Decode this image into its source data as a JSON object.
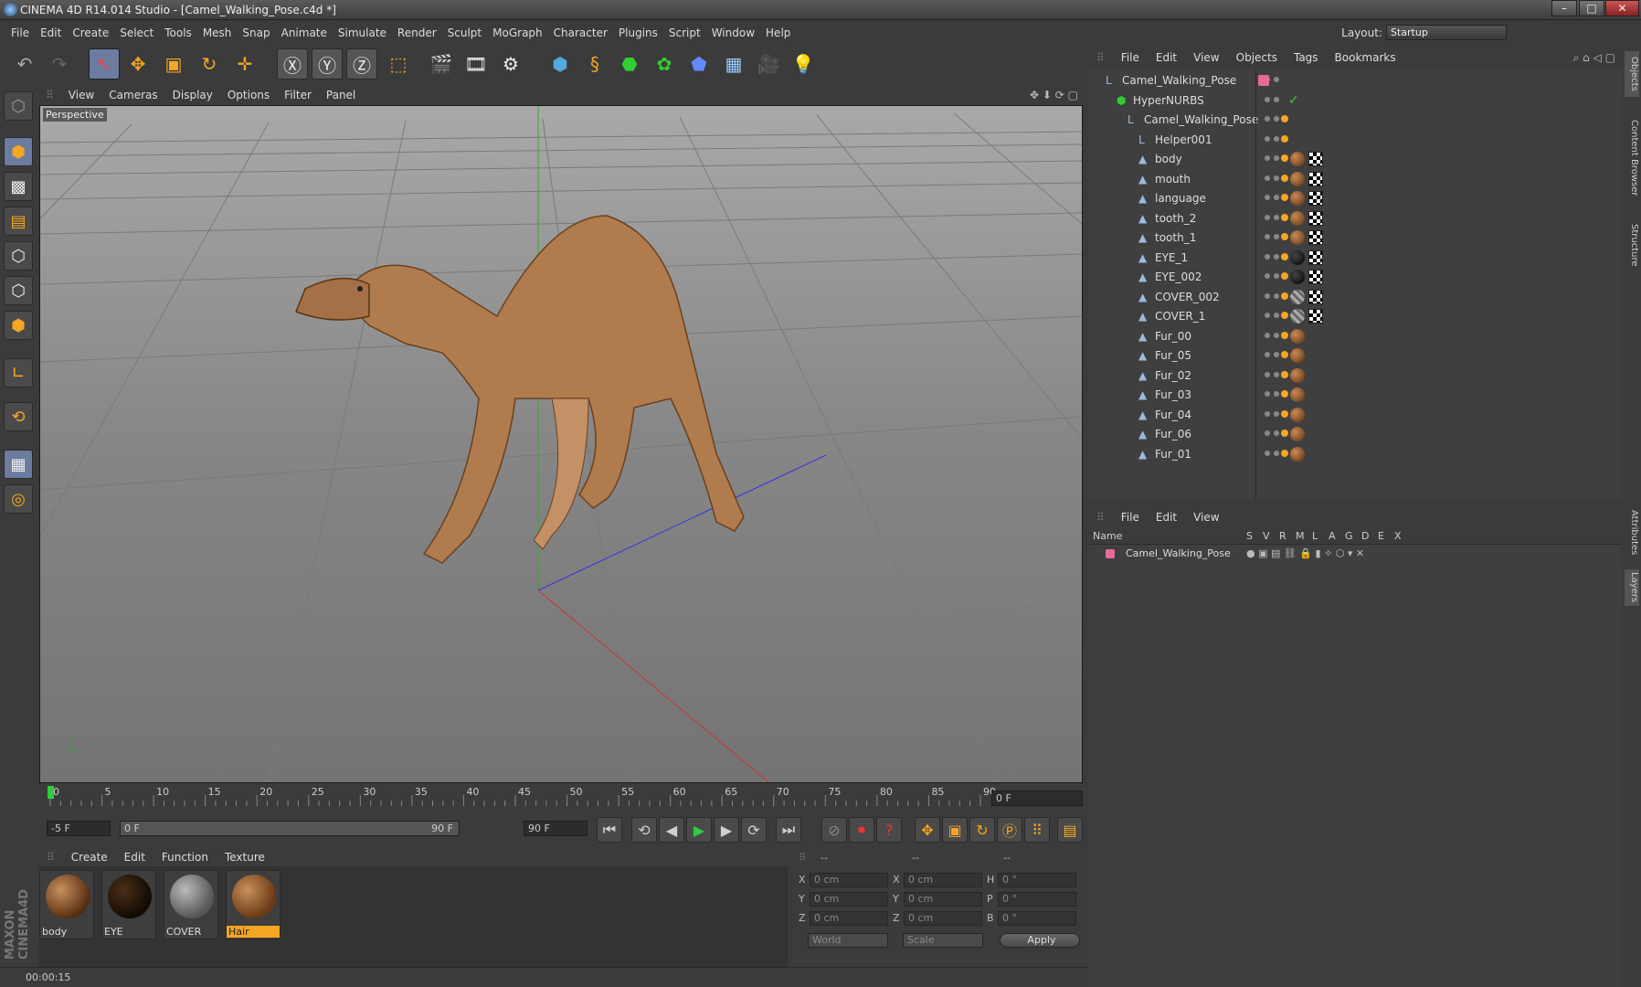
{
  "window": {
    "title": "CINEMA 4D R14.014 Studio - [Camel_Walking_Pose.c4d *]",
    "min": "–",
    "max": "□",
    "close": "✕"
  },
  "menu": [
    "File",
    "Edit",
    "Create",
    "Select",
    "Tools",
    "Mesh",
    "Snap",
    "Animate",
    "Simulate",
    "Render",
    "Sculpt",
    "MoGraph",
    "Character",
    "Plugins",
    "Script",
    "Window",
    "Help"
  ],
  "layout": {
    "label": "Layout:",
    "value": "Startup"
  },
  "viewport": {
    "menu": [
      "View",
      "Cameras",
      "Display",
      "Options",
      "Filter",
      "Panel"
    ],
    "label": "Perspective"
  },
  "timeline": {
    "ticks": [
      "0",
      "5",
      "10",
      "15",
      "20",
      "25",
      "30",
      "35",
      "40",
      "45",
      "50",
      "55",
      "60",
      "65",
      "70",
      "75",
      "80",
      "85",
      "90"
    ],
    "current": "0 F"
  },
  "controls": {
    "start": "-5 F",
    "range_start": "0 F",
    "range_end": "90 F",
    "end": "90 F"
  },
  "materials": {
    "menu": [
      "Create",
      "Edit",
      "Function",
      "Texture"
    ],
    "items": [
      {
        "name": "body",
        "color": "#8a5a30"
      },
      {
        "name": "EYE",
        "color": "#1a1208"
      },
      {
        "name": "COVER",
        "color": "#777777"
      },
      {
        "name": "Hair",
        "color": "#9a6a3a"
      }
    ]
  },
  "coords": {
    "head": [
      "--",
      "--",
      "--"
    ],
    "rows": [
      {
        "a": "X",
        "av": "0 cm",
        "b": "X",
        "bv": "0 cm",
        "c": "H",
        "cv": "0 °"
      },
      {
        "a": "Y",
        "av": "0 cm",
        "b": "Y",
        "bv": "0 cm",
        "c": "P",
        "cv": "0 °"
      },
      {
        "a": "Z",
        "av": "0 cm",
        "b": "Z",
        "bv": "0 cm",
        "c": "B",
        "cv": "0 °"
      }
    ],
    "world": "World",
    "scale": "Scale",
    "apply": "Apply"
  },
  "status": "00:00:15",
  "maxon": "MAXON CINEMA4D",
  "objects": {
    "menu": [
      "File",
      "Edit",
      "View",
      "Objects",
      "Tags",
      "Bookmarks"
    ],
    "items": [
      {
        "name": "Camel_Walking_Pose",
        "indent": 0,
        "icon": "null-icon",
        "tags": "none"
      },
      {
        "name": "HyperNURBS",
        "indent": 1,
        "icon": "hypernurbs-icon",
        "tags": "check"
      },
      {
        "name": "Camel_Walking_Pose",
        "indent": 2,
        "icon": "null-icon",
        "tags": "dot"
      },
      {
        "name": "Helper001",
        "indent": 3,
        "icon": "null-icon",
        "tags": "dot"
      },
      {
        "name": "body",
        "indent": 3,
        "icon": "polygon-icon",
        "tags": "pc"
      },
      {
        "name": "mouth",
        "indent": 3,
        "icon": "polygon-icon",
        "tags": "pc"
      },
      {
        "name": "language",
        "indent": 3,
        "icon": "polygon-icon",
        "tags": "pc"
      },
      {
        "name": "tooth_2",
        "indent": 3,
        "icon": "polygon-icon",
        "tags": "pc"
      },
      {
        "name": "tooth_1",
        "indent": 3,
        "icon": "polygon-icon",
        "tags": "pc"
      },
      {
        "name": "EYE_1",
        "indent": 3,
        "icon": "polygon-icon",
        "tags": "ec"
      },
      {
        "name": "EYE_002",
        "indent": 3,
        "icon": "polygon-icon",
        "tags": "ec"
      },
      {
        "name": "COVER_002",
        "indent": 3,
        "icon": "polygon-icon",
        "tags": "gc"
      },
      {
        "name": "COVER_1",
        "indent": 3,
        "icon": "polygon-icon",
        "tags": "gc"
      },
      {
        "name": "Fur_00",
        "indent": 3,
        "icon": "polygon-icon",
        "tags": "p"
      },
      {
        "name": "Fur_05",
        "indent": 3,
        "icon": "polygon-icon",
        "tags": "p"
      },
      {
        "name": "Fur_02",
        "indent": 3,
        "icon": "polygon-icon",
        "tags": "p"
      },
      {
        "name": "Fur_03",
        "indent": 3,
        "icon": "polygon-icon",
        "tags": "p"
      },
      {
        "name": "Fur_04",
        "indent": 3,
        "icon": "polygon-icon",
        "tags": "p"
      },
      {
        "name": "Fur_06",
        "indent": 3,
        "icon": "polygon-icon",
        "tags": "p"
      },
      {
        "name": "Fur_01",
        "indent": 3,
        "icon": "polygon-icon",
        "tags": "p"
      }
    ]
  },
  "layers": {
    "menu": [
      "File",
      "Edit",
      "View"
    ],
    "head": [
      "Name",
      "S",
      "V",
      "R",
      "M",
      "L",
      "A",
      "G",
      "D",
      "E",
      "X"
    ],
    "row": "Camel_Walking_Pose",
    "row_color": "#e86a9a"
  },
  "righttabs": [
    "Objects",
    "Content Browser",
    "Structure",
    "Attributes",
    "Layers"
  ],
  "colors": {
    "selection": "#6b7ca0",
    "accent_green": "#2ecc40",
    "accent_orange": "#f5a623"
  }
}
